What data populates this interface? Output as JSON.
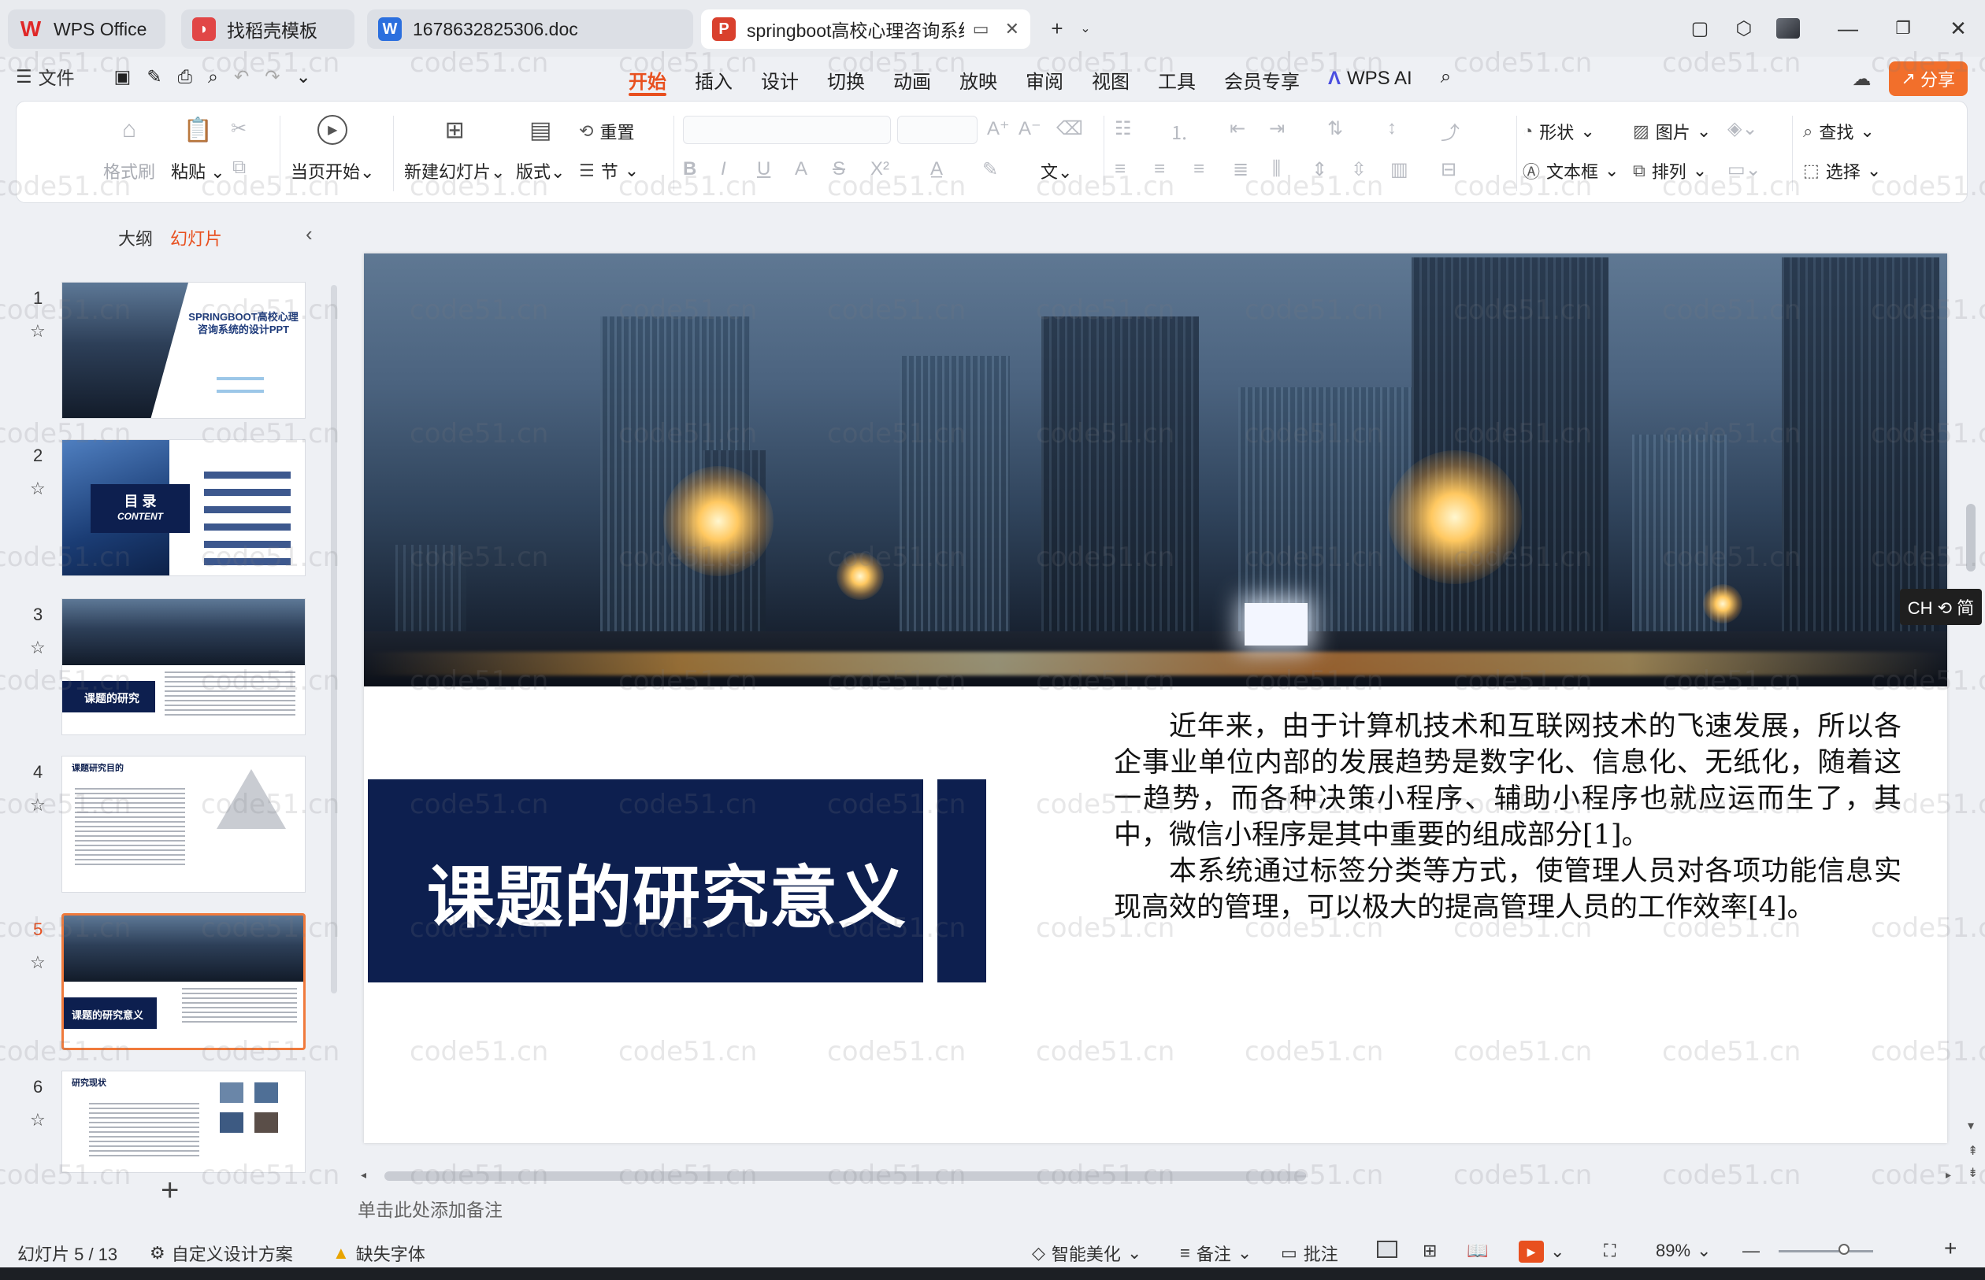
{
  "tabs": [
    {
      "label": "WPS Office",
      "icon": "wps-logo-icon",
      "color": "#e02828"
    },
    {
      "label": "找稻壳模板",
      "icon": "docer-icon",
      "color": "#e14646"
    },
    {
      "label": "1678632825306.doc",
      "icon": "word-doc-icon",
      "color": "#2b6fde"
    },
    {
      "label": "springboot高校心理咨询系统",
      "icon": "ppt-doc-icon",
      "color": "#d9402d"
    }
  ],
  "menu": {
    "file": "文件",
    "tabs": [
      "开始",
      "插入",
      "设计",
      "切换",
      "动画",
      "放映",
      "审阅",
      "视图",
      "工具",
      "会员专享"
    ],
    "active_tab": "开始",
    "wps_ai": "WPS AI",
    "share": "分享"
  },
  "ribbon": {
    "format_painter": "格式刷",
    "paste": "粘贴",
    "play_from_current": "当页开始",
    "new_slide": "新建幻灯片",
    "layout": "版式",
    "reset": "重置",
    "section": "节",
    "shape": "形状",
    "picture": "图片",
    "find": "查找",
    "textbox": "文本框",
    "arrange": "排列",
    "select": "选择"
  },
  "panel": {
    "outline_tab": "大纲",
    "slides_tab": "幻灯片",
    "thumbs": [
      {
        "num": "1",
        "title": "SPRINGBOOT高校心理咨询系统的设计PPT"
      },
      {
        "num": "2",
        "title": "目 录",
        "subtitle": "CONTENT"
      },
      {
        "num": "3",
        "title": "课题的研究"
      },
      {
        "num": "4",
        "title": "课题研究目的"
      },
      {
        "num": "5",
        "title": "课题的研究意义"
      },
      {
        "num": "6",
        "title": "研究现状"
      }
    ],
    "active": "5"
  },
  "slide": {
    "title": "课题的研究意义",
    "paragraphs": [
      "近年来，由于计算机技术和互联网技术的飞速发展，所以各企事业单位内部的发展趋势是数字化、信息化、无纸化，随着这一趋势，而各种决策小程序、辅助小程序也就应运而生了，其中，微信小程序是其中重要的组成部分[1]。",
      "本系统通过标签分类等方式，使管理人员对各项功能信息实现高效的管理，可以极大的提高管理人员的工作效率[4]。"
    ]
  },
  "ime": "CH ⟲ 简",
  "notes_placeholder": "单击此处添加备注",
  "status": {
    "slide_counter": "幻灯片 5 / 13",
    "custom_design": "自定义设计方案",
    "missing_font": "缺失字体",
    "beautify": "智能美化",
    "notes": "备注",
    "comments": "批注",
    "zoom": "89%"
  },
  "watermark": "code51.cn",
  "colors": {
    "accent": "#e8501f",
    "navy": "#0d1f4f",
    "share": "#f26f2b"
  }
}
